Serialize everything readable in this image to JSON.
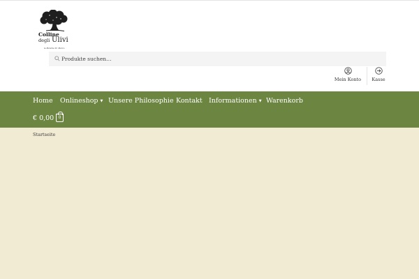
{
  "logo": {
    "line1": "Colline",
    "line2": "degli",
    "line3": "Ulivi",
    "tagline": "le Pianche Sr. Marco"
  },
  "search": {
    "placeholder": "Produkte suchen…"
  },
  "account": {
    "mein_konto": "Mein Konto",
    "kasse": "Kasse"
  },
  "nav": {
    "items": [
      {
        "label": "Home"
      },
      {
        "label": "Onlineshop"
      },
      {
        "label": "Unsere Philosophie"
      },
      {
        "label": "Kontakt"
      },
      {
        "label": "Informationen"
      },
      {
        "label": "Warenkorb"
      }
    ],
    "cart_total": "€ 0,00",
    "cart_count": "0"
  },
  "breadcrumb": "Startseite",
  "colors": {
    "nav_bg": "#6c8540",
    "page_bg": "#f1ebd4",
    "header_bg": "#ffffff"
  },
  "icons": [
    "search-icon",
    "user-icon",
    "arrow-right-circle-icon",
    "chevron-down-icon",
    "shopping-bag-icon",
    "olive-tree-logo"
  ]
}
